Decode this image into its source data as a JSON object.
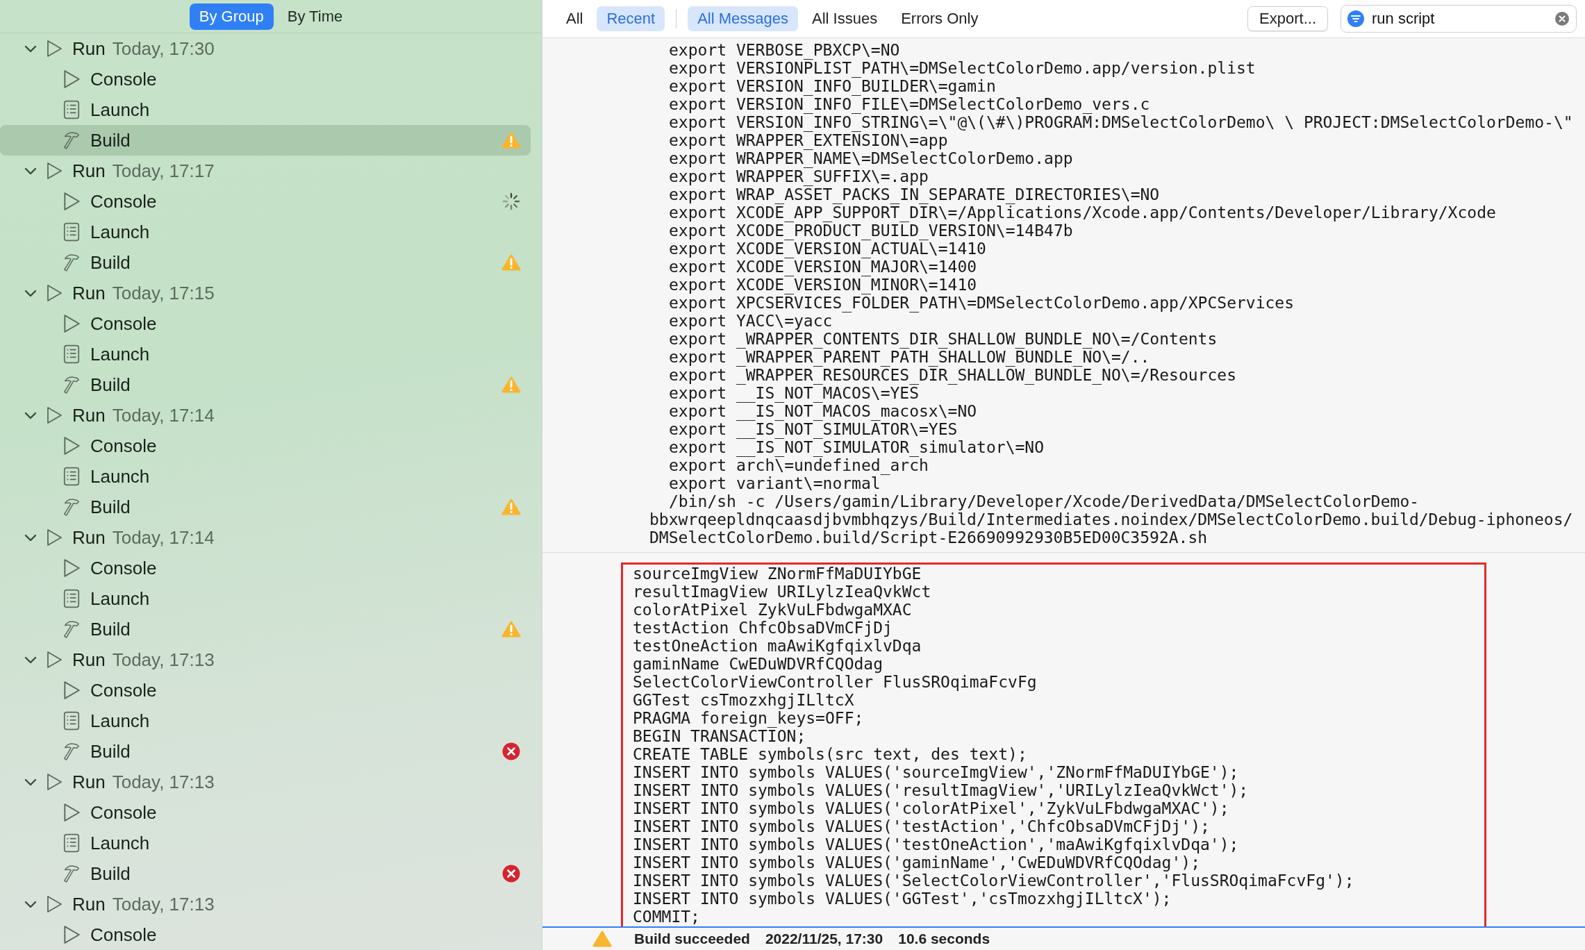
{
  "sidebar": {
    "group_modes": [
      {
        "label": "By Group",
        "selected": true
      },
      {
        "label": "By Time",
        "selected": false
      }
    ],
    "runs": [
      {
        "label": "Run",
        "time": "Today, 17:30",
        "expanded": true,
        "children": [
          {
            "kind": "console",
            "label": "Console",
            "selected": false
          },
          {
            "kind": "launch",
            "label": "Launch",
            "selected": false
          },
          {
            "kind": "build",
            "label": "Build",
            "has_warning": true,
            "selected": true
          }
        ]
      },
      {
        "label": "Run",
        "time": "Today, 17:17",
        "expanded": true,
        "children": [
          {
            "kind": "console",
            "label": "Console",
            "in_progress": true,
            "selected": false
          },
          {
            "kind": "launch",
            "label": "Launch",
            "selected": false
          },
          {
            "kind": "build",
            "label": "Build",
            "has_warning": true,
            "selected": false
          }
        ]
      },
      {
        "label": "Run",
        "time": "Today, 17:15",
        "expanded": true,
        "children": [
          {
            "kind": "console",
            "label": "Console",
            "selected": false
          },
          {
            "kind": "launch",
            "label": "Launch",
            "selected": false
          },
          {
            "kind": "build",
            "label": "Build",
            "has_warning": true,
            "selected": false
          }
        ]
      },
      {
        "label": "Run",
        "time": "Today, 17:14",
        "expanded": true,
        "children": [
          {
            "kind": "console",
            "label": "Console",
            "selected": false
          },
          {
            "kind": "launch",
            "label": "Launch",
            "selected": false
          },
          {
            "kind": "build",
            "label": "Build",
            "has_warning": true,
            "selected": false
          }
        ]
      },
      {
        "label": "Run",
        "time": "Today, 17:14",
        "expanded": true,
        "children": [
          {
            "kind": "console",
            "label": "Console",
            "selected": false
          },
          {
            "kind": "launch",
            "label": "Launch",
            "selected": false
          },
          {
            "kind": "build",
            "label": "Build",
            "has_warning": true,
            "selected": false
          }
        ]
      },
      {
        "label": "Run",
        "time": "Today, 17:13",
        "expanded": true,
        "children": [
          {
            "kind": "console",
            "label": "Console",
            "selected": false
          },
          {
            "kind": "launch",
            "label": "Launch",
            "selected": false
          },
          {
            "kind": "build",
            "label": "Build",
            "has_error": true,
            "selected": false
          }
        ]
      },
      {
        "label": "Run",
        "time": "Today, 17:13",
        "expanded": true,
        "children": [
          {
            "kind": "console",
            "label": "Console",
            "selected": false
          },
          {
            "kind": "launch",
            "label": "Launch",
            "selected": false
          },
          {
            "kind": "build",
            "label": "Build",
            "has_error": true,
            "selected": false
          }
        ]
      },
      {
        "label": "Run",
        "time": "Today, 17:13",
        "expanded": true,
        "children": [
          {
            "kind": "console",
            "label": "Console",
            "selected": false
          }
        ]
      }
    ]
  },
  "toolbar": {
    "scopes": [
      {
        "label": "All",
        "selected": false
      },
      {
        "label": "Recent",
        "selected": true
      }
    ],
    "filters": [
      {
        "label": "All Messages",
        "selected": true
      },
      {
        "label": "All Issues",
        "selected": false
      },
      {
        "label": "Errors Only",
        "selected": false
      }
    ],
    "export_button": "Export...",
    "search": {
      "value": "run script"
    }
  },
  "log": {
    "output_lines": [
      {
        "kind": "output",
        "text": "export VERBOSE_PBXCP\\=NO"
      },
      {
        "kind": "output",
        "text": "export VERSIONPLIST_PATH\\=DMSelectColorDemo.app/version.plist"
      },
      {
        "kind": "output",
        "text": "export VERSION_INFO_BUILDER\\=gamin"
      },
      {
        "kind": "output",
        "text": "export VERSION_INFO_FILE\\=DMSelectColorDemo_vers.c"
      },
      {
        "kind": "output",
        "text": "export VERSION_INFO_STRING\\=\\\"@\\(\\#\\)PROGRAM:DMSelectColorDemo\\ \\ PROJECT:DMSelectColorDemo-\\\""
      },
      {
        "kind": "output",
        "text": "export WRAPPER_EXTENSION\\=app"
      },
      {
        "kind": "output",
        "text": "export WRAPPER_NAME\\=DMSelectColorDemo.app"
      },
      {
        "kind": "output",
        "text": "export WRAPPER_SUFFIX\\=.app"
      },
      {
        "kind": "output",
        "text": "export WRAP_ASSET_PACKS_IN_SEPARATE_DIRECTORIES\\=NO"
      },
      {
        "kind": "output",
        "text": "export XCODE_APP_SUPPORT_DIR\\=/Applications/Xcode.app/Contents/Developer/Library/Xcode"
      },
      {
        "kind": "output",
        "text": "export XCODE_PRODUCT_BUILD_VERSION\\=14B47b"
      },
      {
        "kind": "output",
        "text": "export XCODE_VERSION_ACTUAL\\=1410"
      },
      {
        "kind": "output",
        "text": "export XCODE_VERSION_MAJOR\\=1400"
      },
      {
        "kind": "output",
        "text": "export XCODE_VERSION_MINOR\\=1410"
      },
      {
        "kind": "output",
        "text": "export XPCSERVICES_FOLDER_PATH\\=DMSelectColorDemo.app/XPCServices"
      },
      {
        "kind": "output",
        "text": "export YACC\\=yacc"
      },
      {
        "kind": "output",
        "text": "export _WRAPPER_CONTENTS_DIR_SHALLOW_BUNDLE_NO\\=/Contents"
      },
      {
        "kind": "output",
        "text": "export _WRAPPER_PARENT_PATH_SHALLOW_BUNDLE_NO\\=/.."
      },
      {
        "kind": "output",
        "text": "export _WRAPPER_RESOURCES_DIR_SHALLOW_BUNDLE_NO\\=/Resources"
      },
      {
        "kind": "output",
        "text": "export __IS_NOT_MACOS\\=YES"
      },
      {
        "kind": "output",
        "text": "export __IS_NOT_MACOS_macosx\\=NO"
      },
      {
        "kind": "output",
        "text": "export __IS_NOT_SIMULATOR\\=YES"
      },
      {
        "kind": "output",
        "text": "export __IS_NOT_SIMULATOR_simulator\\=NO"
      },
      {
        "kind": "output",
        "text": "export arch\\=undefined_arch"
      },
      {
        "kind": "output",
        "text": "export variant\\=normal"
      },
      {
        "kind": "output",
        "text": "/bin/sh -c /Users/gamin/Library/Developer/Xcode/DerivedData/DMSelectColorDemo-"
      },
      {
        "kind": "continuation",
        "text": "bbxwrqeepldnqcaasdjbvmbhqzys/Build/Intermediates.noindex/DMSelectColorDemo.build/Debug-iphoneos/"
      },
      {
        "kind": "continuation",
        "text": "DMSelectColorDemo.build/Script-E26690992930B5ED00C3592A.sh"
      }
    ],
    "script_output": [
      "sourceImgView ZNormFfMaDUIYbGE",
      "resultImagView URILylzIeaQvkWct",
      "colorAtPixel ZykVuLFbdwgaMXAC",
      "testAction ChfcObsaDVmCFjDj",
      "testOneAction maAwiKgfqixlvDqa",
      "gaminName CwEDuWDVRfCQOdag",
      "SelectColorViewController FlusSROqimaFcvFg",
      "GGTest csTmozxhgjILltcX",
      "PRAGMA foreign_keys=OFF;",
      "BEGIN TRANSACTION;",
      "CREATE TABLE symbols(src text, des text);",
      "INSERT INTO symbols VALUES('sourceImgView','ZNormFfMaDUIYbGE');",
      "INSERT INTO symbols VALUES('resultImagView','URILylzIeaQvkWct');",
      "INSERT INTO symbols VALUES('colorAtPixel','ZykVuLFbdwgaMXAC');",
      "INSERT INTO symbols VALUES('testAction','ChfcObsaDVmCFjDj');",
      "INSERT INTO symbols VALUES('testOneAction','maAwiKgfqixlvDqa');",
      "INSERT INTO symbols VALUES('gaminName','CwEDuWDVRfCQOdag');",
      "INSERT INTO symbols VALUES('SelectColorViewController','FlusSROqimaFcvFg');",
      "INSERT INTO symbols VALUES('GGTest','csTmozxhgjILltcX');",
      "COMMIT;"
    ]
  },
  "status_bar": {
    "has_warning": true,
    "message": "Build succeeded",
    "date": "2022/11/25, 17:30",
    "duration": "10.6 seconds"
  }
}
